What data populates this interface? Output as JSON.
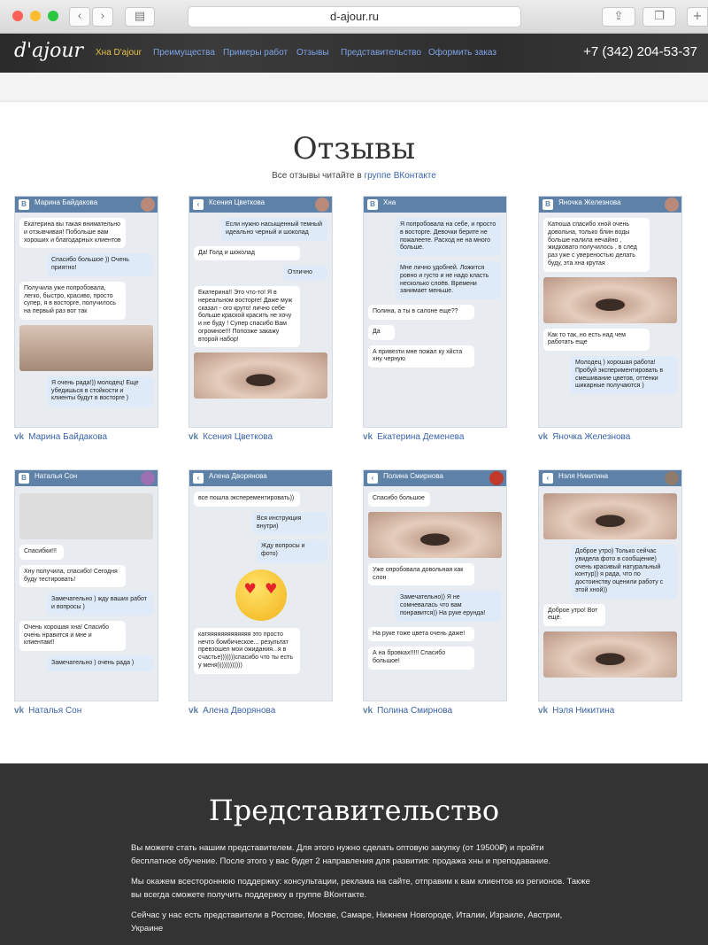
{
  "browser": {
    "url": "d-ajour.ru"
  },
  "nav": {
    "logo": "d'ajour",
    "items": [
      "Хна D'ajour",
      "Преимущества",
      "Примеры работ",
      "Отзывы",
      "Представительство",
      "Оформить заказ"
    ],
    "phone": "+7 (342) 204-53-37"
  },
  "reviews": {
    "title": "Отзывы",
    "subtitle_prefix": "Все отзывы читайте в ",
    "subtitle_link": "группе ВКонтакте",
    "cards": [
      {
        "name": "Марина Байдакова",
        "status": "Была в сети сегодня в 6:05",
        "messages": [
          "Екатерина вы такая внимательно и отзывчивая! Побольше вам хороших и благодарных клиентов",
          "Спасибо большое )) Очень приятно!",
          "Получила уже попробовала, легко, быстро, красиво, просто супер, я в восторге, получилось на первый раз вот так",
          "Я очень рада!)) молодец! Еще убедишься в стойкости и клиенты будут в восторге )"
        ],
        "caption": "Марина Байдакова"
      },
      {
        "name": "Ксения Цветкова",
        "status": "заходила сегодня в 2:07",
        "messages": [
          "Если нужно насыщенный темный идеально черный и шоколад",
          "Да! Голд и шоколад",
          "Отлично",
          "Екатерина!! Это что-то! Я в нереальном восторге! Даже муж сказал - ого круто! лично себе больше краской красить не хочу и не буду ! Супер спасибо Вам огромное!!! Попозже закажу второй набор!"
        ],
        "caption": "Ксения Цветкова"
      },
      {
        "name": "Хна",
        "status": "23 участника",
        "messages": [
          "Я попробовала на себе, и просто в восторге. Девочки берите не пожалеете. Расход не на много больше.",
          "Мне лично удобней. Ложится ровно и густо и не надо класть несколько слоёв. Времени занимает меньше.",
          "Полина, а ты в салоне еще??",
          "Да",
          "А привезти мне пожал ку хйста хну черную"
        ],
        "caption": "Екатерина Деменева"
      },
      {
        "name": "Яночка Железнова",
        "status": "Онлайн",
        "messages": [
          "Катюша спасибо хной очень довольна, только блин воды больше налила нечайно , жидковато получилось , в след раз уже с увереностью делать буду, эта хна крутая",
          "Как то так, но есть над чем работать еще",
          "Молодец ) хорошая работа! Пробуй экспериментировать в смешивание цветов, оттенки шикарные получаются )"
        ],
        "caption": "Яночка Железнова"
      },
      {
        "name": "Наталья Сон",
        "status": "был в сети сегодня в 13:39",
        "messages": [
          "Спасибки!!!",
          "Хну получила, спасибо! Сегодня буду тестировать!",
          "Замечательно ) жду ваших работ и вопросы )",
          "Очень хорошая хна! Спасибо очень нравится и мне и клиентам!!",
          "Замечательно ) очень рада )"
        ],
        "caption": "Наталья Сон"
      },
      {
        "name": "Алена Дворянова",
        "status": "",
        "messages": [
          "все пошла эксперементировать))",
          "Вся инструкция внутри)",
          "Жду вопросы и фото)",
          "катяяяяяяяяяяяяя это просто нечто бомбическое... результат превзошел мои ожидания...я в счастье)))))))спасибо что ты есть у меня))))))))))))"
        ],
        "caption": "Алена Дворянова"
      },
      {
        "name": "Полина Смирнова",
        "status": "online (моб.)",
        "messages": [
          "Спасибо большое",
          "Уже опробовала довольная как слон",
          "Замечательно)) Я не сомневалась что вам понравится)) На руке ерунда!",
          "На руке тоже цвета очень даже!",
          "А на бровках!!!!! Спасибо большое!",
          "Пожалуйста))"
        ],
        "caption": "Полина Смирнова"
      },
      {
        "name": "Нэля Никитина",
        "status": "заходила 16 минут назад",
        "messages": [
          "Доброе утро) Только сейчас увидела фото в сообщение) очень красивый натуральный контур)) я рада, что по достоинству оценили работу с этой хной))",
          "Доброе утро! Вот ещё."
        ],
        "caption": "Нэля Никитина"
      }
    ]
  },
  "partnership": {
    "title": "Представительство",
    "p1": "Вы можете стать нашим представителем. Для этого нужно сделать оптовую закупку (от 19500₽) и пройти бесплатное обучение. После этого у вас будет 2 направления для развития: продажа хны и преподавание.",
    "p2": "Мы окажем всестороннюю поддержку: консультации, реклама на сайте, отправим к вам клиентов из регионов. Также вы всегда сможете получить поддержку в группе ВКонтакте.",
    "p3": "Сейчас у нас есть представители в Ростове, Москве, Самаре, Нижнем Новгороде, Италии, Израиле, Австрии, Украине"
  }
}
